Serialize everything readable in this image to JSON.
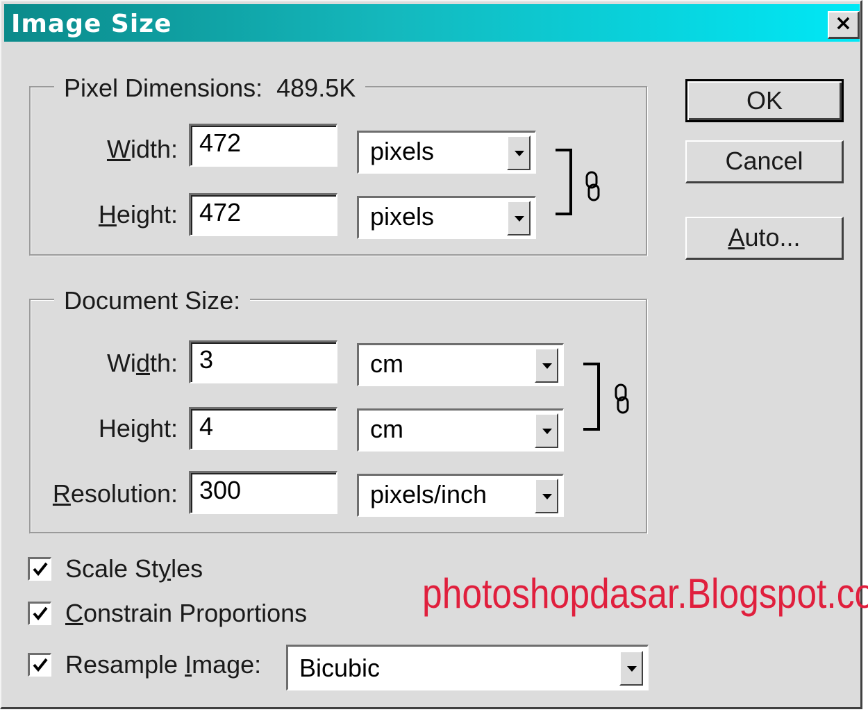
{
  "window": {
    "title": "Image Size",
    "close_label": "×"
  },
  "pixel_dimensions": {
    "legend": "Pixel Dimensions:",
    "size": "489.5K",
    "width": {
      "label": "Width:",
      "mnemonic": "W",
      "rest": "idth:",
      "value": "472",
      "unit": "pixels"
    },
    "height": {
      "label": "Height:",
      "mnemonic": "H",
      "rest": "eight:",
      "value": "472",
      "unit": "pixels"
    }
  },
  "document_size": {
    "legend": "Document Size:",
    "width": {
      "label": "Width:",
      "pre": "Wi",
      "mnemonic": "d",
      "rest": "th:",
      "value": "3",
      "unit": "cm"
    },
    "height": {
      "label": "Height:",
      "pre": "Hei",
      "mnemonic": "g",
      "rest": "ht:",
      "value": "4",
      "unit": "cm"
    },
    "resolution": {
      "label": "Resolution:",
      "mnemonic": "R",
      "rest": "esolution:",
      "value": "300",
      "unit": "pixels/inch"
    }
  },
  "buttons": {
    "ok": "OK",
    "cancel": "Cancel",
    "auto_mnemonic": "A",
    "auto_rest": "uto..."
  },
  "options": {
    "scale_styles": {
      "pre": "Scale St",
      "mnemonic": "y",
      "rest": "les",
      "checked": true
    },
    "constrain": {
      "mnemonic": "C",
      "rest": "onstrain Proportions",
      "checked": true
    },
    "resample": {
      "pre": "Resample ",
      "mnemonic": "I",
      "rest": "mage:",
      "checked": true,
      "method": "Bicubic"
    }
  },
  "watermark": "photoshopdasar.Blogspot.com",
  "colors": {
    "title_start": "#0b8a8a",
    "title_end": "#00e8f6",
    "dialog_bg": "#dcdcdc",
    "watermark": "#e01f3d"
  }
}
